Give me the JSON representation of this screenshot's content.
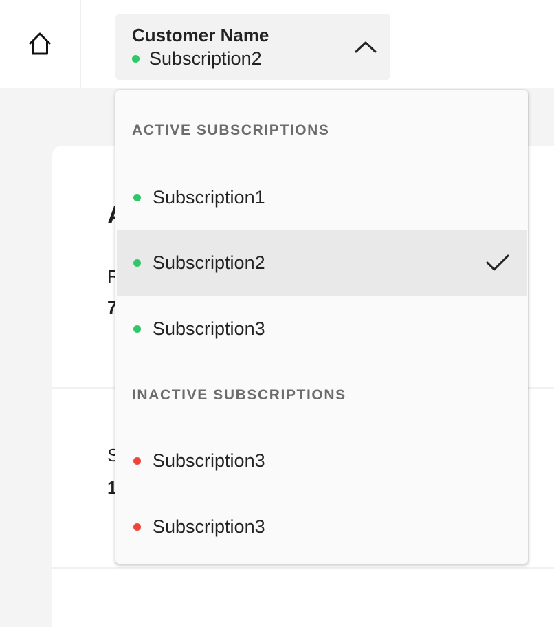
{
  "header": {
    "home_icon": "home-icon",
    "subscription_select": {
      "customer_name": "Customer Name",
      "selected_subscription": "Subscription2",
      "selected_status_color": "#2ec866",
      "toggle_icon": "chevron-up-icon"
    }
  },
  "background": {
    "heading": "A",
    "text1": "R",
    "text2": "7",
    "text3": "S",
    "text4": "1"
  },
  "dropdown": {
    "groups": [
      {
        "label": "ACTIVE SUBSCRIPTIONS",
        "items": [
          {
            "label": "Subscription1",
            "status_color": "#2ec866",
            "selected": false
          },
          {
            "label": "Subscription2",
            "status_color": "#2ec866",
            "selected": true,
            "check_icon": "checkmark-icon"
          },
          {
            "label": "Subscription3",
            "status_color": "#2ec866",
            "selected": false
          }
        ]
      },
      {
        "label": "INACTIVE SUBSCRIPTIONS",
        "items": [
          {
            "label": "Subscription3",
            "status_color": "#f04438",
            "selected": false
          },
          {
            "label": "Subscription3",
            "status_color": "#f04438",
            "selected": false
          }
        ]
      }
    ]
  }
}
